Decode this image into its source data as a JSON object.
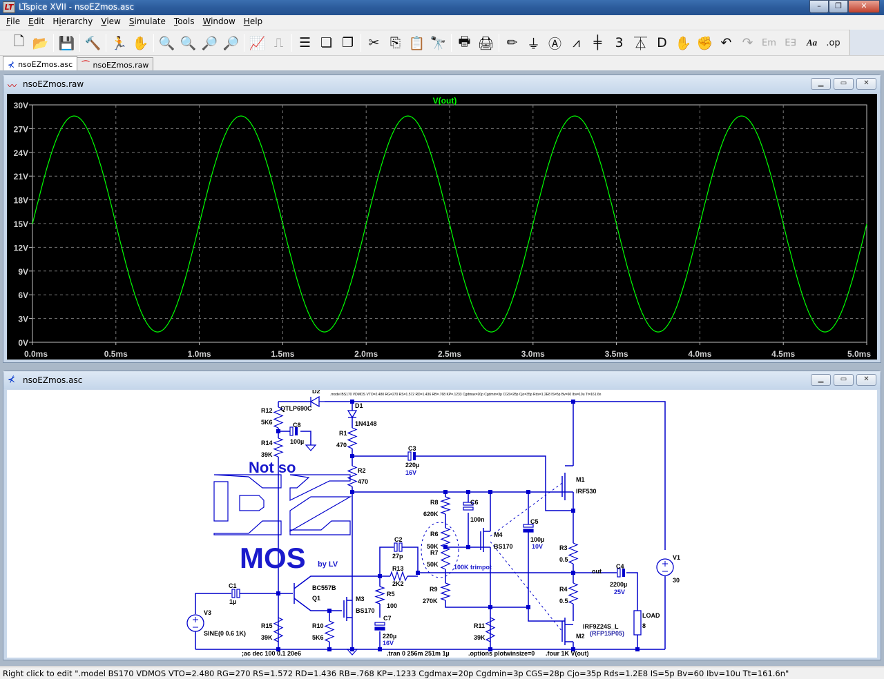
{
  "window": {
    "title": "LTspice XVII - nsoEZmos.asc",
    "minimize": "–",
    "maximize": "❐",
    "close": "✕"
  },
  "menu": [
    {
      "label": "File",
      "mnemonic": "F"
    },
    {
      "label": "Edit",
      "mnemonic": "E"
    },
    {
      "label": "Hierarchy",
      "mnemonic": "i"
    },
    {
      "label": "View",
      "mnemonic": "V"
    },
    {
      "label": "Simulate",
      "mnemonic": "S"
    },
    {
      "label": "Tools",
      "mnemonic": "T"
    },
    {
      "label": "Window",
      "mnemonic": "W"
    },
    {
      "label": "Help",
      "mnemonic": "H"
    }
  ],
  "toolbar": [
    {
      "name": "new-schematic",
      "glyph": "🗋",
      "enabled": true
    },
    {
      "name": "open",
      "glyph": "📂",
      "enabled": true
    },
    {
      "sep": true
    },
    {
      "name": "save",
      "glyph": "💾",
      "enabled": true
    },
    {
      "sep": true
    },
    {
      "name": "control-panel",
      "glyph": "🔨",
      "enabled": true
    },
    {
      "sep": true
    },
    {
      "name": "run",
      "glyph": "🏃",
      "enabled": true
    },
    {
      "name": "halt",
      "glyph": "✋",
      "enabled": false
    },
    {
      "sep": true
    },
    {
      "name": "zoom-in",
      "glyph": "🔍",
      "enabled": true
    },
    {
      "name": "zoom-pan",
      "glyph": "🔍",
      "enabled": false
    },
    {
      "name": "zoom-out",
      "glyph": "🔎",
      "enabled": true
    },
    {
      "name": "zoom-fit",
      "glyph": "🔎",
      "enabled": true
    },
    {
      "sep": true
    },
    {
      "name": "autorange",
      "glyph": "📈",
      "enabled": true
    },
    {
      "name": "pick-visible-traces",
      "glyph": "⎍",
      "enabled": false
    },
    {
      "sep": true
    },
    {
      "name": "tile-horizontal",
      "glyph": "☰",
      "enabled": true
    },
    {
      "name": "cascade",
      "glyph": "❏",
      "enabled": true
    },
    {
      "name": "close-window",
      "glyph": "❐",
      "enabled": true
    },
    {
      "sep": true
    },
    {
      "name": "cut",
      "glyph": "✂",
      "enabled": true
    },
    {
      "name": "copy",
      "glyph": "⎘",
      "enabled": true
    },
    {
      "name": "paste",
      "glyph": "📋",
      "enabled": false
    },
    {
      "name": "find",
      "glyph": "🔭",
      "enabled": true
    },
    {
      "sep": true
    },
    {
      "name": "print-setup",
      "glyph": "🖶",
      "enabled": true
    },
    {
      "name": "print",
      "glyph": "🖨",
      "enabled": true
    },
    {
      "sep": true
    },
    {
      "name": "draw-wire",
      "glyph": "✏",
      "enabled": true
    },
    {
      "name": "ground",
      "glyph": "⏚",
      "enabled": true
    },
    {
      "name": "label-net",
      "glyph": "Ⓐ",
      "enabled": true
    },
    {
      "name": "resistor",
      "glyph": "⩘",
      "enabled": true
    },
    {
      "name": "capacitor",
      "glyph": "╪",
      "enabled": true
    },
    {
      "name": "inductor",
      "glyph": "3",
      "enabled": true
    },
    {
      "name": "diode",
      "glyph": "⏄",
      "enabled": true
    },
    {
      "name": "component",
      "glyph": "D",
      "enabled": true
    },
    {
      "name": "move",
      "glyph": "✋",
      "enabled": true
    },
    {
      "name": "drag",
      "glyph": "✊",
      "enabled": true
    },
    {
      "name": "undo",
      "glyph": "↶",
      "enabled": true
    },
    {
      "name": "redo",
      "glyph": "↷",
      "enabled": false
    },
    {
      "name": "rotate",
      "glyph": "Em",
      "enabled": false
    },
    {
      "name": "mirror",
      "glyph": "E∃",
      "enabled": false
    },
    {
      "name": "text",
      "glyph": "Aa",
      "enabled": true
    },
    {
      "name": "spice-directive",
      "glyph": ".op",
      "enabled": true
    }
  ],
  "tabs": [
    {
      "label": "nsoEZmos.asc",
      "icon": "schematic-icon",
      "active": true
    },
    {
      "label": "nsoEZmos.raw",
      "icon": "waveform-icon",
      "active": false
    }
  ],
  "waveform_window": {
    "title": "nsoEZmos.raw",
    "buttons": {
      "minimize": "▁",
      "restore": "▭",
      "close": "✕"
    }
  },
  "schematic_window": {
    "title": "nsoEZmos.asc",
    "buttons": {
      "minimize": "▁",
      "restore": "▭",
      "close": "✕"
    }
  },
  "chart_data": {
    "type": "line",
    "title": "V(out)",
    "xlabel": "",
    "ylabel": "",
    "x_ticks": [
      "0.0ms",
      "0.5ms",
      "1.0ms",
      "1.5ms",
      "2.0ms",
      "2.5ms",
      "3.0ms",
      "3.5ms",
      "4.0ms",
      "4.5ms",
      "5.0ms"
    ],
    "y_ticks": [
      "0V",
      "3V",
      "6V",
      "9V",
      "12V",
      "15V",
      "18V",
      "21V",
      "24V",
      "27V",
      "30V"
    ],
    "xlim_ms": [
      0,
      5
    ],
    "ylim_V": [
      0,
      30
    ],
    "grid": true,
    "series": [
      {
        "name": "V(out)",
        "color": "#00ff00",
        "waveform": "sine",
        "offset_V": 14.95,
        "amplitude_V": 13.65,
        "frequency_kHz": 1.0,
        "phase_deg": 0,
        "peak_V": 28.6,
        "trough_V": 1.3
      }
    ],
    "trace_label_color": "#00ff00",
    "axis_label_color": "#d0d0d0"
  },
  "schematic": {
    "model_directive": ".model BS170 VDMOS VTO=2.480 RG=270 RS=1.572 RD=1.436 RB=.768 KP=.1233 Cgdmax=20p Cgdmin=3p CGS=28p Cjo=35p Rds=1.2E8 IS=5p Bv=60 Ibv=10u Tt=161.6n",
    "logo": {
      "line1": "Not so",
      "line2": "MOS",
      "byline": "by LV"
    },
    "components": {
      "D2": {
        "name": "D2",
        "value": "QTLP690C"
      },
      "D1": {
        "name": "D1",
        "value": "1N4148"
      },
      "R12": {
        "name": "R12",
        "value": "5K6"
      },
      "R14": {
        "name": "R14",
        "value": "39K"
      },
      "C8": {
        "name": "C8",
        "value": "100µ"
      },
      "R1": {
        "name": "R1",
        "value": "470"
      },
      "R2": {
        "name": "R2",
        "value": "470"
      },
      "C3": {
        "name": "C3",
        "value": "220µ",
        "rating": "16V"
      },
      "M1": {
        "name": "M1",
        "value": "IRF530"
      },
      "C6": {
        "name": "C6",
        "value": "100n"
      },
      "R8": {
        "name": "R8",
        "value": "620K"
      },
      "R6": {
        "name": "R6",
        "value": "50K"
      },
      "R7": {
        "name": "R7",
        "value": "50K"
      },
      "trimpot": "100K trimpot",
      "M4": {
        "name": "M4",
        "value": "BS170"
      },
      "C5": {
        "name": "C5",
        "value": "100µ",
        "rating": "10V"
      },
      "R3": {
        "name": "R3",
        "value": "0.5"
      },
      "R4": {
        "name": "R4",
        "value": "0.5"
      },
      "C4": {
        "name": "C4",
        "value": "2200µ",
        "rating": "25V"
      },
      "out_net": "out",
      "V1": {
        "name": "V1",
        "value": "30"
      },
      "LOAD": {
        "name": "LOAD",
        "value": "8"
      },
      "M2": {
        "name": "M2",
        "value": "IRF9Z24S_L",
        "alt": "(RFP15P05)"
      },
      "C2": {
        "name": "C2",
        "value": "27p"
      },
      "R13": {
        "name": "R13",
        "value": "2K2"
      },
      "R5": {
        "name": "R5",
        "value": "100"
      },
      "C7": {
        "name": "C7",
        "value": "220µ",
        "rating": "16V"
      },
      "R9": {
        "name": "R9",
        "value": "270K"
      },
      "R11": {
        "name": "R11",
        "value": "39K"
      },
      "C1": {
        "name": "C1",
        "value": "1µ"
      },
      "V3": {
        "name": "V3",
        "value": "SINE(0 0.6 1K)"
      },
      "Q1": {
        "name": "Q1",
        "value": "BC557B"
      },
      "M3": {
        "name": "M3",
        "value": "BS170"
      },
      "R15": {
        "name": "R15",
        "value": "39K"
      },
      "R10": {
        "name": "R10",
        "value": "5K6"
      }
    },
    "directives": {
      "ac": ";ac dec 100 0.1 20e6",
      "tran": ".tran 0 256m 251m 1µ",
      "options": ".options plotwinsize=0",
      "four": ".four 1K V(out)"
    }
  },
  "status_bar": "Right click to edit \".model BS170 VDMOS VTO=2.480 RG=270 RS=1.572 RD=1.436 RB=.768 KP=.1233 Cgdmax=20p Cgdmin=3p CGS=28p Cjo=35p Rds=1.2E8 IS=5p Bv=60 Ibv=10u Tt=161.6n\""
}
